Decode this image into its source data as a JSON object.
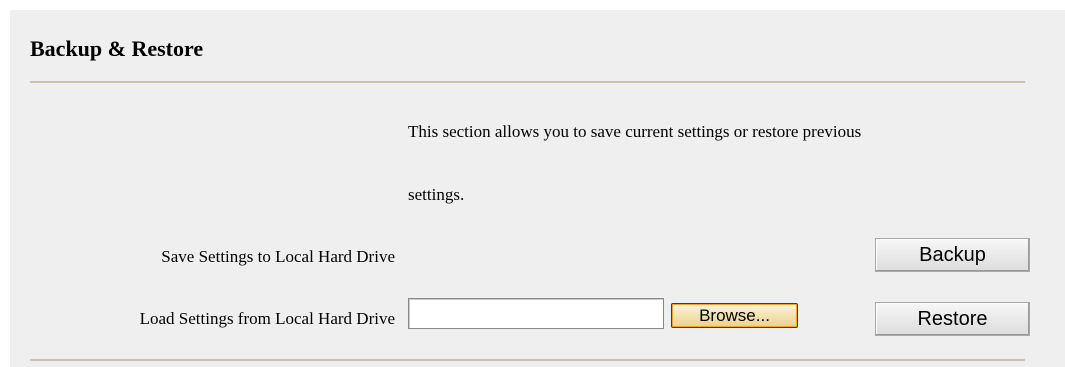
{
  "header": {
    "title": "Backup & Restore"
  },
  "description": {
    "line1": "This section allows you to save current settings or restore previous",
    "line2": "settings."
  },
  "backup_row": {
    "label": "Save Settings to Local Hard Drive",
    "button_label": "Backup"
  },
  "restore_row": {
    "label": "Load Settings from Local Hard Drive",
    "file_value": "",
    "browse_label": "Browse...",
    "button_label": "Restore"
  },
  "colors": {
    "panel_background": "#efefef",
    "divider": "#c9c2ad",
    "browse_focus": "#f0a430"
  }
}
